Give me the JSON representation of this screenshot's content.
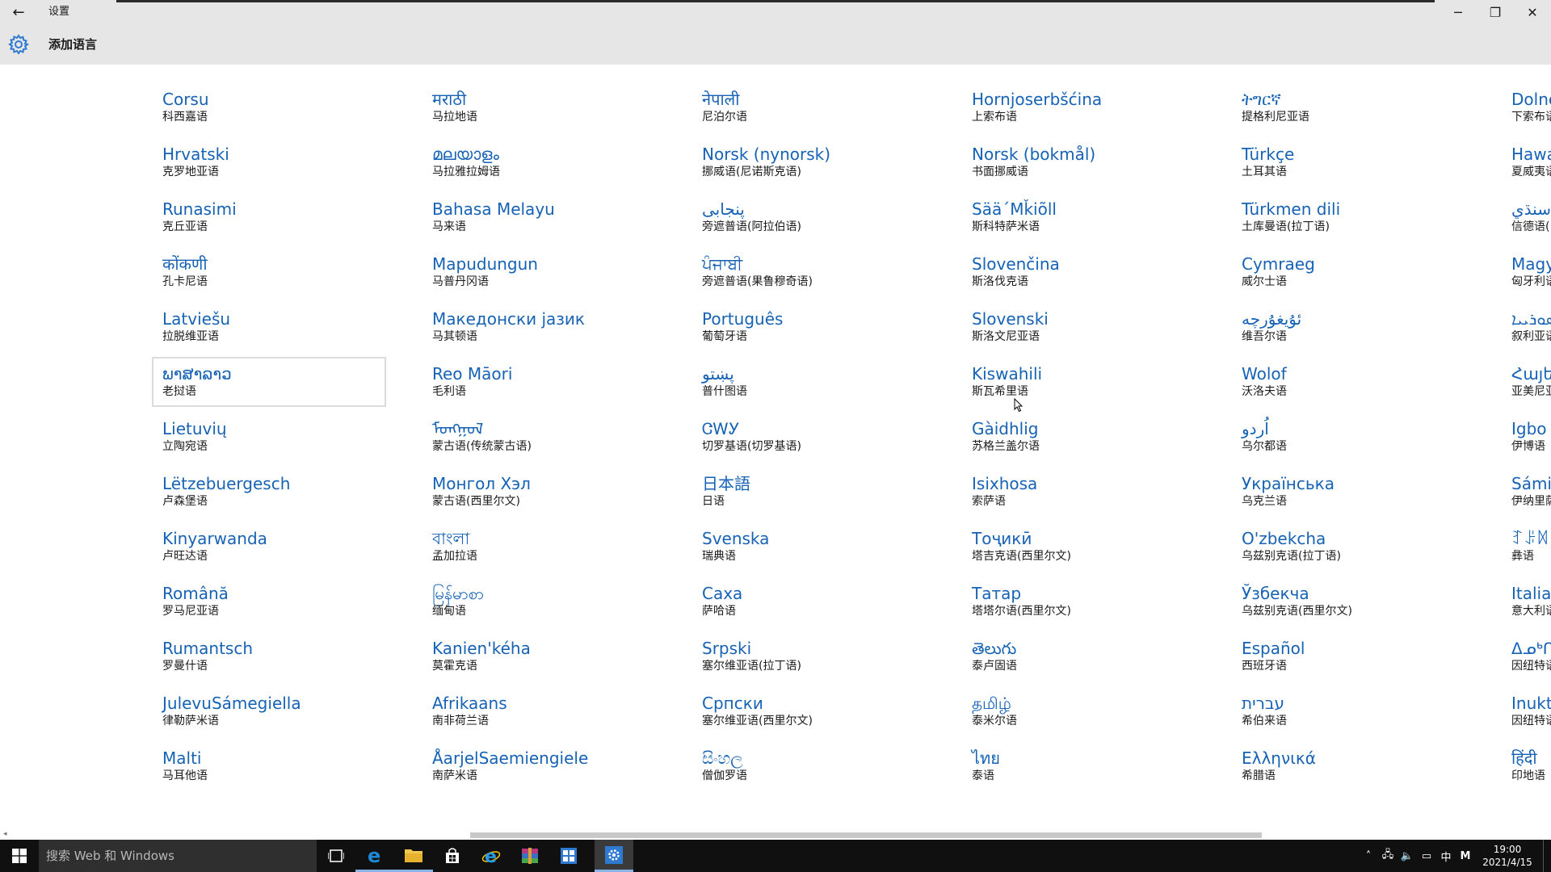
{
  "window": {
    "title": "设置",
    "page_title": "添加语言",
    "controls": {
      "back": "←",
      "minimize": "─",
      "maximize": "❐",
      "close": "✕"
    }
  },
  "columns": [
    [
      {
        "native": "Corsu",
        "cn": "科西嘉语"
      },
      {
        "native": "Hrvatski",
        "cn": "克罗地亚语"
      },
      {
        "native": "Runasimi",
        "cn": "克丘亚语"
      },
      {
        "native": "कोंकणी",
        "cn": "孔卡尼语"
      },
      {
        "native": "Latviešu",
        "cn": "拉脱维亚语"
      },
      {
        "native": "ພາສາລາວ",
        "cn": "老挝语"
      },
      {
        "native": "Lietuvių",
        "cn": "立陶宛语"
      },
      {
        "native": "Lëtzebuergesch",
        "cn": "卢森堡语"
      },
      {
        "native": "Kinyarwanda",
        "cn": "卢旺达语"
      },
      {
        "native": "Română",
        "cn": "罗马尼亚语"
      },
      {
        "native": "Rumantsch",
        "cn": "罗曼什语"
      },
      {
        "native": "JulevuSámegiella",
        "cn": "律勒萨米语"
      },
      {
        "native": "Malti",
        "cn": "马耳他语"
      }
    ],
    [
      {
        "native": "मराठी",
        "cn": "马拉地语"
      },
      {
        "native": "മലയാളം",
        "cn": "马拉雅拉姆语"
      },
      {
        "native": "Bahasa Melayu",
        "cn": "马来语"
      },
      {
        "native": "Mapudungun",
        "cn": "马普丹冈语"
      },
      {
        "native": "Македонски јазик",
        "cn": "马其顿语"
      },
      {
        "native": "Reo Māori",
        "cn": "毛利语"
      },
      {
        "native": "ᠮᠣᠩᠭᠣᠯ",
        "cn": "蒙古语(传统蒙古语)"
      },
      {
        "native": "Монгол Хэл",
        "cn": "蒙古语(西里尔文)"
      },
      {
        "native": "বাংলা",
        "cn": "孟加拉语"
      },
      {
        "native": "မြန်မာစာ",
        "cn": "缅甸语"
      },
      {
        "native": "Kanien'kéha",
        "cn": "莫霍克语"
      },
      {
        "native": "Afrikaans",
        "cn": "南非荷兰语"
      },
      {
        "native": "ÅarjelSaemiengiele",
        "cn": "南萨米语"
      }
    ],
    [
      {
        "native": "नेपाली",
        "cn": "尼泊尔语"
      },
      {
        "native": "Norsk (nynorsk)",
        "cn": "挪威语(尼诺斯克语)"
      },
      {
        "native": "پنجابی",
        "cn": "旁遮普语(阿拉伯语)"
      },
      {
        "native": "ਪੰਜਾਬੀ",
        "cn": "旁遮普语(果鲁穆奇语)"
      },
      {
        "native": "Português",
        "cn": "葡萄牙语"
      },
      {
        "native": "پښتو",
        "cn": "普什图语"
      },
      {
        "native": "ᏣᎳᎩ",
        "cn": "切罗基语(切罗基语)"
      },
      {
        "native": "日本語",
        "cn": "日语"
      },
      {
        "native": "Svenska",
        "cn": "瑞典语"
      },
      {
        "native": "Саха",
        "cn": "萨哈语"
      },
      {
        "native": "Srpski",
        "cn": "塞尔维亚语(拉丁语)"
      },
      {
        "native": "Српски",
        "cn": "塞尔维亚语(西里尔文)"
      },
      {
        "native": "සිංහල",
        "cn": "僧伽罗语"
      }
    ],
    [
      {
        "native": "Hornjoserbšćina",
        "cn": "上索布语"
      },
      {
        "native": "Norsk (bokmål)",
        "cn": "书面挪威语"
      },
      {
        "native": "Sää´Mǩiõll",
        "cn": "斯科特萨米语"
      },
      {
        "native": "Slovenčina",
        "cn": "斯洛伐克语"
      },
      {
        "native": "Slovenski",
        "cn": "斯洛文尼亚语"
      },
      {
        "native": "Kiswahili",
        "cn": "斯瓦希里语"
      },
      {
        "native": "Gàidhlig",
        "cn": "苏格兰盖尔语"
      },
      {
        "native": "Isixhosa",
        "cn": "索萨语"
      },
      {
        "native": "Тоҷикӣ",
        "cn": "塔吉克语(西里尔文)"
      },
      {
        "native": "Татар",
        "cn": "塔塔尔语(西里尔文)"
      },
      {
        "native": "తెలుగు",
        "cn": "泰卢固语"
      },
      {
        "native": "தமிழ்",
        "cn": "泰米尔语"
      },
      {
        "native": "ไทย",
        "cn": "泰语"
      }
    ],
    [
      {
        "native": "ትግርኛ",
        "cn": "提格利尼亚语"
      },
      {
        "native": "Türkçe",
        "cn": "土耳其语"
      },
      {
        "native": "Türkmen dili",
        "cn": "土库曼语(拉丁语)"
      },
      {
        "native": "Cymraeg",
        "cn": "威尔士语"
      },
      {
        "native": "ئۇيغۇرچە",
        "cn": "维吾尔语"
      },
      {
        "native": "Wolof",
        "cn": "沃洛夫语"
      },
      {
        "native": "اُردو",
        "cn": "乌尔都语"
      },
      {
        "native": "Українська",
        "cn": "乌克兰语"
      },
      {
        "native": "O'zbekcha",
        "cn": "乌兹别克语(拉丁语)"
      },
      {
        "native": "Ўзбекча",
        "cn": "乌兹别克语(西里尔文)"
      },
      {
        "native": "Español",
        "cn": "西班牙语"
      },
      {
        "native": "עברית",
        "cn": "希伯来语"
      },
      {
        "native": "Ελληνικά",
        "cn": "希腊语"
      }
    ],
    [
      {
        "native": "Dolnc",
        "cn": "下索布语"
      },
      {
        "native": "Hawa",
        "cn": "夏威夷语"
      },
      {
        "native": "سنڌي",
        "cn": "信德语("
      },
      {
        "native": "Magy",
        "cn": "匈牙利语"
      },
      {
        "native": "ܣܘܪܝܝܐ",
        "cn": "叙利亚语"
      },
      {
        "native": "Հայերե",
        "cn": "亚美尼亚语"
      },
      {
        "native": "Igbo",
        "cn": "伊博语"
      },
      {
        "native": "Sámik",
        "cn": "伊纳里萨"
      },
      {
        "native": "ꆈꌠꉙ",
        "cn": "彝语"
      },
      {
        "native": "Italian",
        "cn": "意大利语"
      },
      {
        "native": "ᐃᓄᒃᑎ",
        "cn": "因纽特语"
      },
      {
        "native": "Inukti",
        "cn": "因纽特语"
      },
      {
        "native": "हिंदी",
        "cn": "印地语"
      }
    ]
  ],
  "selected": {
    "column": 0,
    "row": 5
  },
  "taskbar": {
    "search_placeholder": "搜索 Web 和 Windows",
    "apps": [
      "task-view-icon",
      "edge-icon",
      "file-explorer-icon",
      "store-icon",
      "ie-icon",
      "winrar-icon",
      "photos-icon",
      "settings-icon"
    ],
    "ime": "中",
    "ime_mode": "M",
    "time": "19:00",
    "date": "2021/4/15"
  },
  "colors": {
    "link": "#1662b5",
    "header_bg": "#e6e6e6",
    "taskbar_bg": "#101010",
    "gear": "#2f7ad1"
  }
}
